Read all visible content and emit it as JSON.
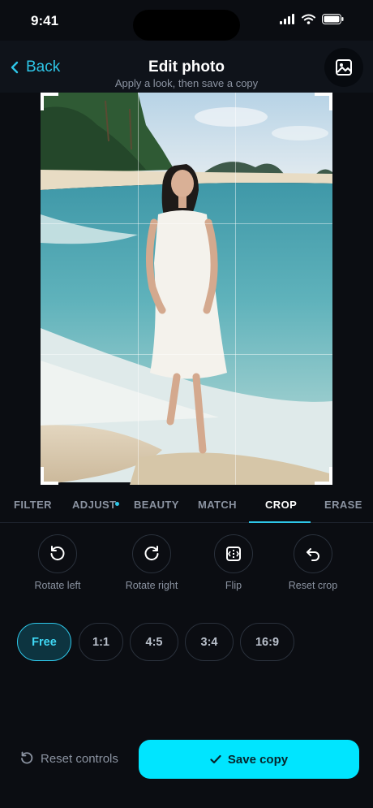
{
  "status_bar": {
    "time": "9:41"
  },
  "header": {
    "back_label": "Back",
    "title": "Edit photo",
    "subtitle": "Apply a look, then save a copy"
  },
  "photo": {
    "alt": "Woman in a white dress walking along a tropical beach shoreline"
  },
  "tabs": [
    {
      "label": "FILTER",
      "active": false
    },
    {
      "label": "ADJUST",
      "active": false,
      "has_dot": true
    },
    {
      "label": "BEAUTY",
      "active": false
    },
    {
      "label": "MATCH",
      "active": false
    },
    {
      "label": "CROP",
      "active": true
    },
    {
      "label": "ERASE",
      "active": false
    }
  ],
  "tools": [
    {
      "label": "Rotate left",
      "icon": "rotate-left-icon"
    },
    {
      "label": "Rotate right",
      "icon": "rotate-right-icon"
    },
    {
      "label": "Flip",
      "icon": "flip-icon"
    },
    {
      "label": "Reset crop",
      "icon": "undo-icon"
    }
  ],
  "ratios": [
    {
      "label": "Free",
      "active": true
    },
    {
      "label": "1:1",
      "active": false
    },
    {
      "label": "4:5",
      "active": false
    },
    {
      "label": "3:4",
      "active": false
    },
    {
      "label": "16:9",
      "active": false
    }
  ],
  "footer": {
    "reset_label": "Reset controls",
    "save_label": "Save copy"
  },
  "colors": {
    "accent": "#00e5ff",
    "background": "#0b0d12",
    "muted_text": "#8b93a1"
  }
}
